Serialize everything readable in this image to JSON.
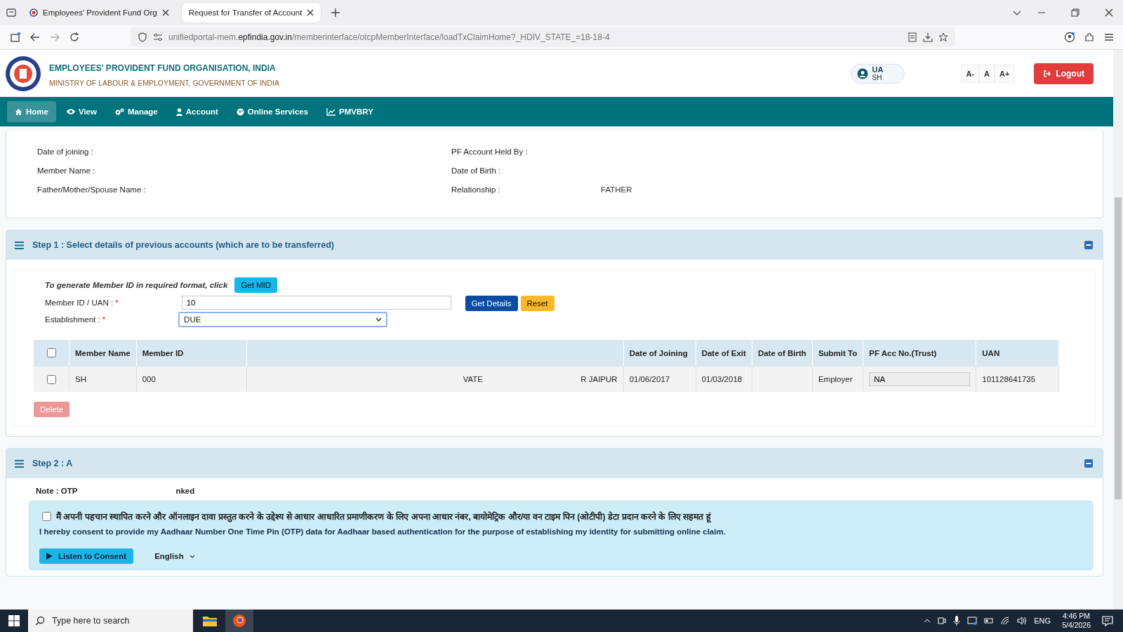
{
  "browser": {
    "tabs": [
      {
        "title": "Employees' Provident Fund Org",
        "selected": false
      },
      {
        "title": "Request for Transfer of Account",
        "selected": true
      }
    ],
    "url": "unifiedportal-mem.**epfindia.gov.in**/memberinterface/otcpMemberInterface/loadTxClaimHome?_HDIV_STATE_=18-18-4"
  },
  "header": {
    "org": "EMPLOYEES' PROVIDENT FUND ORGANISATION, INDIA",
    "ministry": "MINISTRY OF LABOUR & EMPLOYMENT, GOVERNMENT OF INDIA",
    "user_lines": [
      "UA",
      "SH"
    ],
    "font_sizes": [
      "A-",
      "A",
      "A+"
    ],
    "logout": "Logout"
  },
  "nav": [
    {
      "label": "Home",
      "selected": true
    },
    {
      "label": "View",
      "selected": false
    },
    {
      "label": "Manage",
      "selected": false
    },
    {
      "label": "Account",
      "selected": false
    },
    {
      "label": "Online Services",
      "selected": false
    },
    {
      "label": "PMVBRY",
      "selected": false
    }
  ],
  "details": {
    "left": [
      {
        "label": "Date of joining :"
      },
      {
        "label": "Member Name :"
      },
      {
        "label": "Father/Mother/Spouse Name :"
      }
    ],
    "right": [
      {
        "label": "PF Account Held By :"
      },
      {
        "label": "Date of Birth :"
      },
      {
        "label": "Relationship :",
        "value": "FATHER"
      }
    ]
  },
  "step1": {
    "title": "Step 1 : Select details of previous accounts (which are to be transferred)",
    "hint": "To generate Member ID in required format, click",
    "get_mid": "Get MID",
    "fields": [
      {
        "kind": "input",
        "label": "Member ID / UAN :",
        "required_mark": "*",
        "value": "10"
      },
      {
        "kind": "select",
        "label": "Establishment :",
        "required_mark": "*",
        "value": "DUE"
      }
    ],
    "buttons": [
      {
        "label": "Get Details",
        "kind": "primary"
      },
      {
        "label": "Reset",
        "kind": "warning"
      }
    ],
    "table": {
      "columns": [
        "Member Name",
        "Member ID",
        "",
        "Date of Joining",
        "Date of Exit",
        "Date of Birth",
        "Submit To",
        "PF Acc No.(Trust)",
        "UAN"
      ],
      "header_checked": false,
      "rows": [
        {
          "checked": false,
          "cells": [
            [
              "SH"
            ],
            [
              "000"
            ],
            [
              "VATE",
              "R JAIPUR"
            ],
            [
              "01/06/2017"
            ],
            [
              "01/03/2018"
            ],
            [],
            [
              "Employer"
            ],
            [],
            [
              "101128641735"
            ]
          ],
          "pf_acc": "NA"
        }
      ]
    },
    "delete": {
      "label": "Delete",
      "disabled": true
    }
  },
  "step2": {
    "title": "Step 2 : A",
    "note": [
      "Note : OTP",
      "nked"
    ],
    "consent": {
      "checked": false,
      "hindi": "मैं अपनी पहचान स्थापित करने और ऑनलाइन दावा प्रस्तुत करने के उद्देश्य से आधार आधारित प्रमाणीकरण के लिए अपना आधार नंबर, बायोमेट्रिक और/या वन टाइम पिन (ओटीपी) डेटा प्रदान करने के लिए सहमत हूं",
      "english": "I hereby consent to provide my Aadhaar Number One Time Pin (OTP) data for Aadhaar based authentication for the purpose of establishing my identity for submitting online claim.",
      "listen": "Listen to Consent",
      "language": "English"
    }
  },
  "taskbar": {
    "search_placeholder": "Type here to search",
    "lang": "ENG",
    "time": "4:46 PM",
    "date": "5/4/2026"
  }
}
